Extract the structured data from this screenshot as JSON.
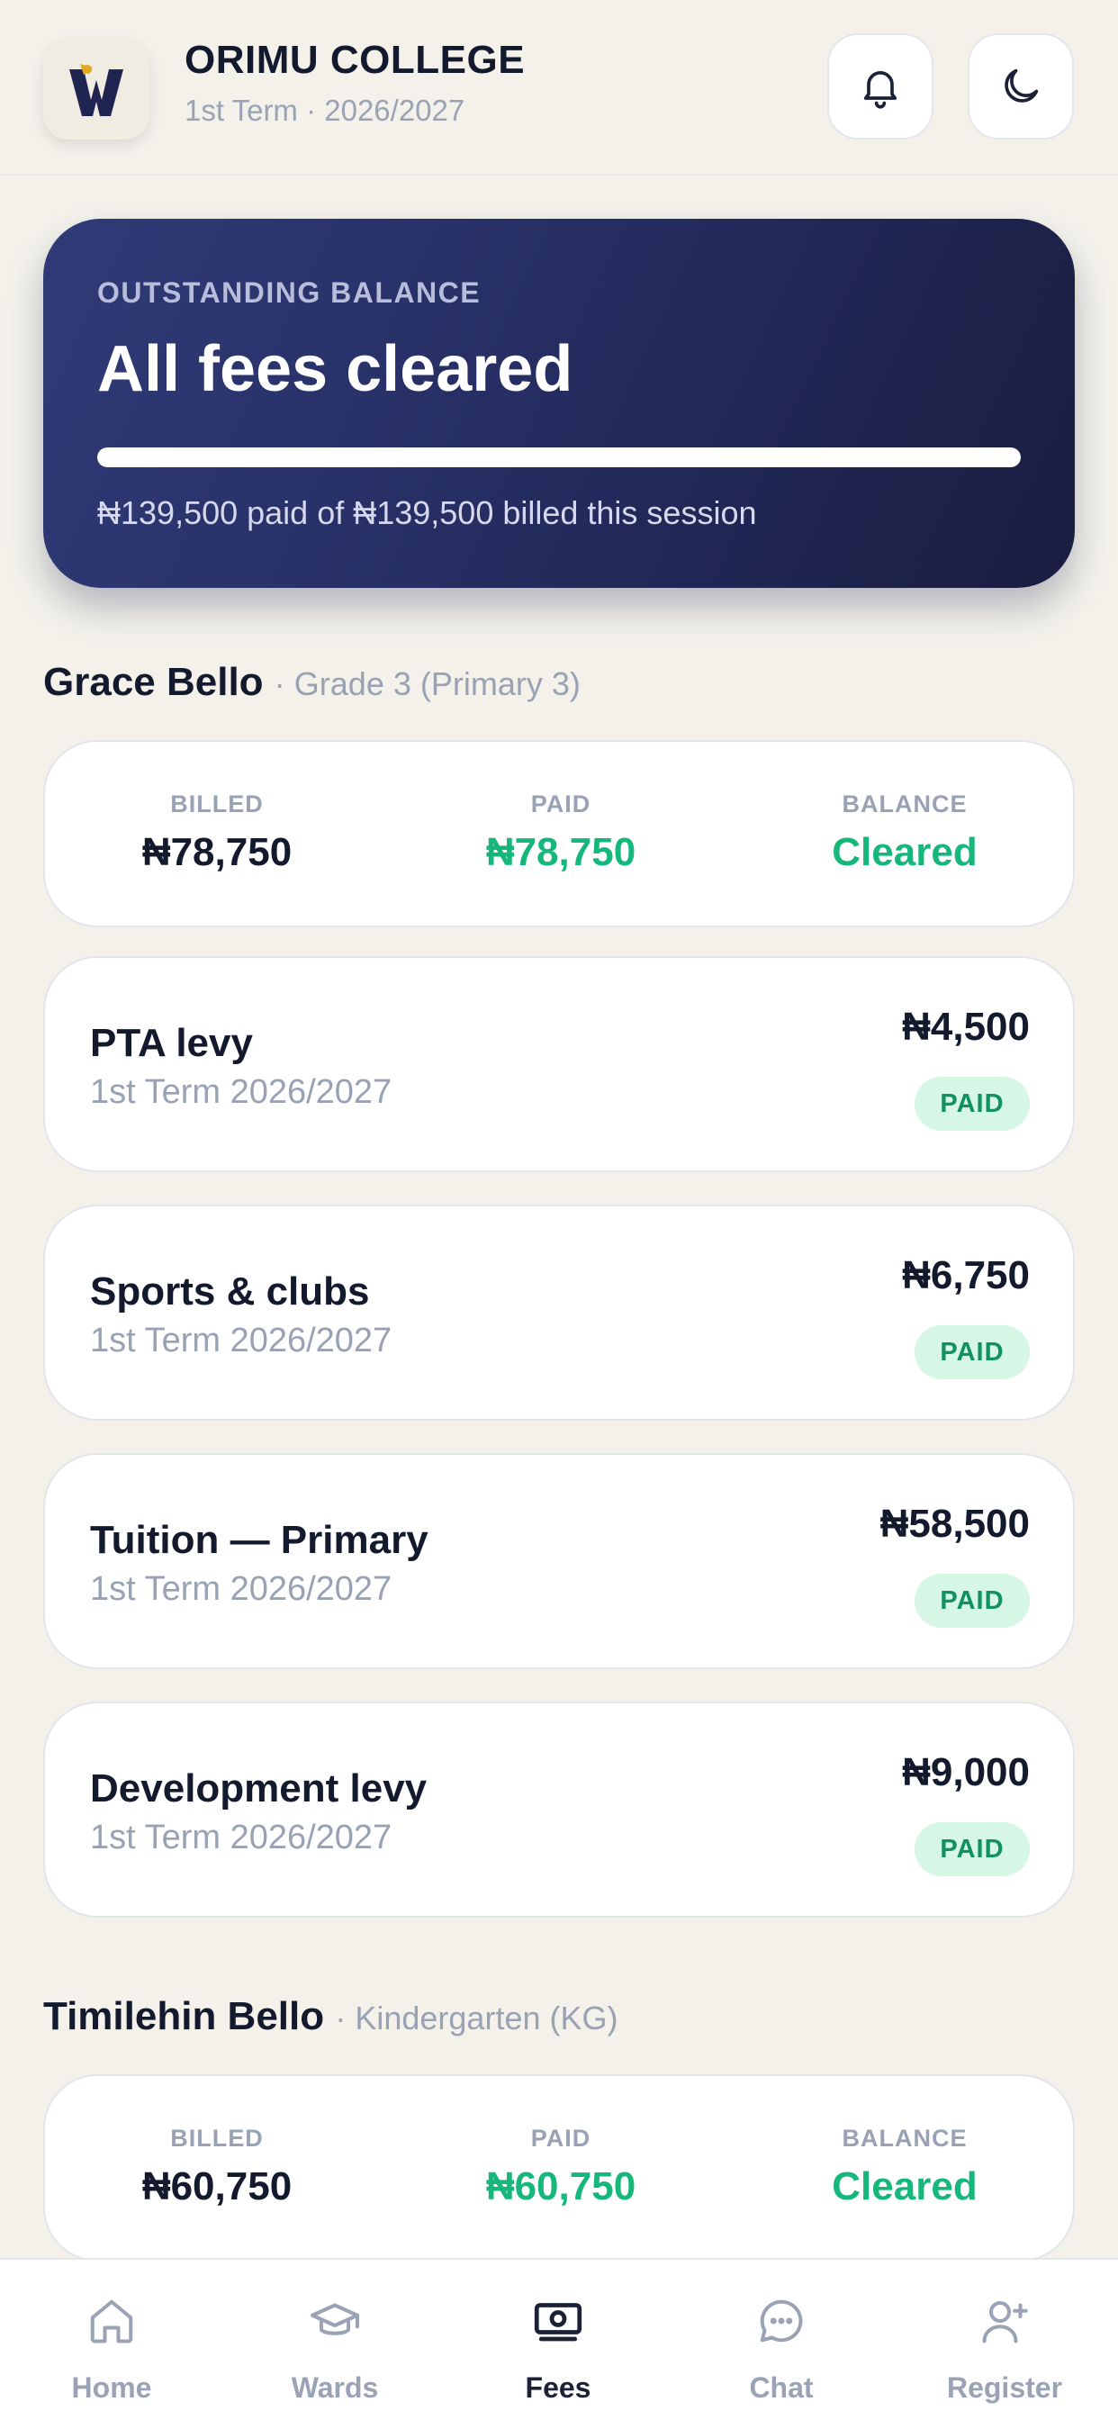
{
  "header": {
    "school_name": "ORIMU COLLEGE",
    "term_line": "1st Term · 2026/2027",
    "logo_icon": "school-crest-icon",
    "notifications_icon": "bell-icon",
    "theme_icon": "moon-icon"
  },
  "balance": {
    "label": "OUTSTANDING BALANCE",
    "title": "All fees cleared",
    "progress_fraction": 1.0,
    "summary": "₦139,500 paid of ₦139,500 billed this session"
  },
  "students": [
    {
      "name": "Grace Bello",
      "grade": "· Grade 3 (Primary 3)",
      "summary": {
        "billed_label": "BILLED",
        "billed": "₦78,750",
        "paid_label": "PAID",
        "paid": "₦78,750",
        "balance_label": "BALANCE",
        "balance": "Cleared"
      },
      "fees": [
        {
          "name": "PTA levy",
          "term": "1st Term 2026/2027",
          "amount": "₦4,500",
          "status": "PAID"
        },
        {
          "name": "Sports & clubs",
          "term": "1st Term 2026/2027",
          "amount": "₦6,750",
          "status": "PAID"
        },
        {
          "name": "Tuition — Primary",
          "term": "1st Term 2026/2027",
          "amount": "₦58,500",
          "status": "PAID"
        },
        {
          "name": "Development levy",
          "term": "1st Term 2026/2027",
          "amount": "₦9,000",
          "status": "PAID"
        }
      ]
    },
    {
      "name": "Timilehin Bello",
      "grade": "· Kindergarten (KG)",
      "summary": {
        "billed_label": "BILLED",
        "billed": "₦60,750",
        "paid_label": "PAID",
        "paid": "₦60,750",
        "balance_label": "BALANCE",
        "balance": "Cleared"
      }
    }
  ],
  "nav": {
    "active": "Fees",
    "items": [
      {
        "label": "Home",
        "icon": "home-icon"
      },
      {
        "label": "Wards",
        "icon": "graduation-cap-icon"
      },
      {
        "label": "Fees",
        "icon": "banknote-icon"
      },
      {
        "label": "Chat",
        "icon": "chat-bubble-icon"
      },
      {
        "label": "Register",
        "icon": "add-user-icon"
      }
    ]
  },
  "colors": {
    "background": "#F3F1EA",
    "card_gradient_start": "#303B78",
    "card_gradient_end": "#1A1D40",
    "accent_green": "#16B77A",
    "badge_bg": "#D6F7E6",
    "text_dark": "#141A2E",
    "text_muted": "#99A2B4"
  }
}
